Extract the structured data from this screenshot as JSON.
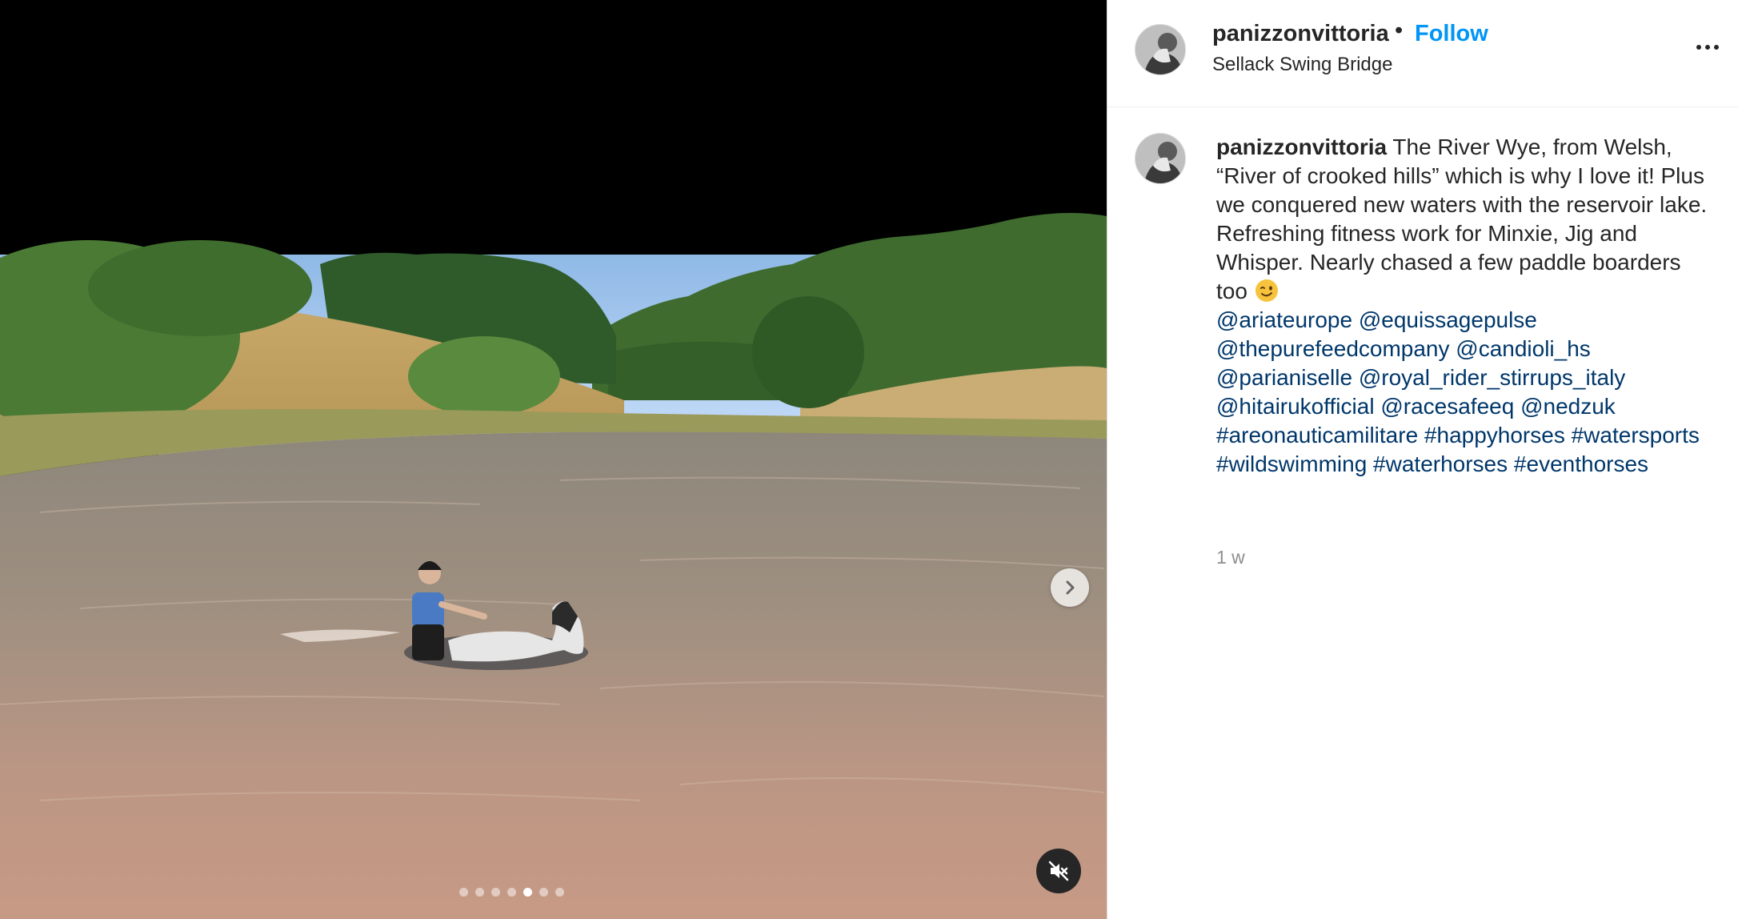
{
  "post": {
    "username": "panizzonvittoria",
    "separator": "•",
    "follow_label": "Follow",
    "location": "Sellack Swing Bridge"
  },
  "media": {
    "type": "video",
    "carousel_count": 7,
    "carousel_active_index": 4,
    "muted": true
  },
  "caption": {
    "username": "panizzonvittoria",
    "line1": "The River Wye, from Welsh, “River of crooked hills” which is why I love it! Plus we conquered new waters with the reservoir lake.",
    "line2": "Refreshing fitness work for Minxie, Jig and Whisper. Nearly chased a few paddle boarders too",
    "emoji": "winking-face",
    "mentions": [
      "@ariateurope",
      "@equissagepulse",
      "@thepurefeedcompany",
      "@candioli_hs",
      "@parianiselle",
      "@royal_rider_stirrups_italy",
      "@hitairukofficial",
      "@racesafeeq",
      "@nedzuk"
    ],
    "hashtags": [
      "#areonauticamilitare",
      "#happyhorses",
      "#watersports",
      "#wildswimming",
      "#waterhorses",
      "#eventhorses"
    ]
  },
  "timestamp": "1 w",
  "icons": {
    "next": "chevron-right-icon",
    "mute": "speaker-muted-icon",
    "more": "more-options-icon"
  }
}
